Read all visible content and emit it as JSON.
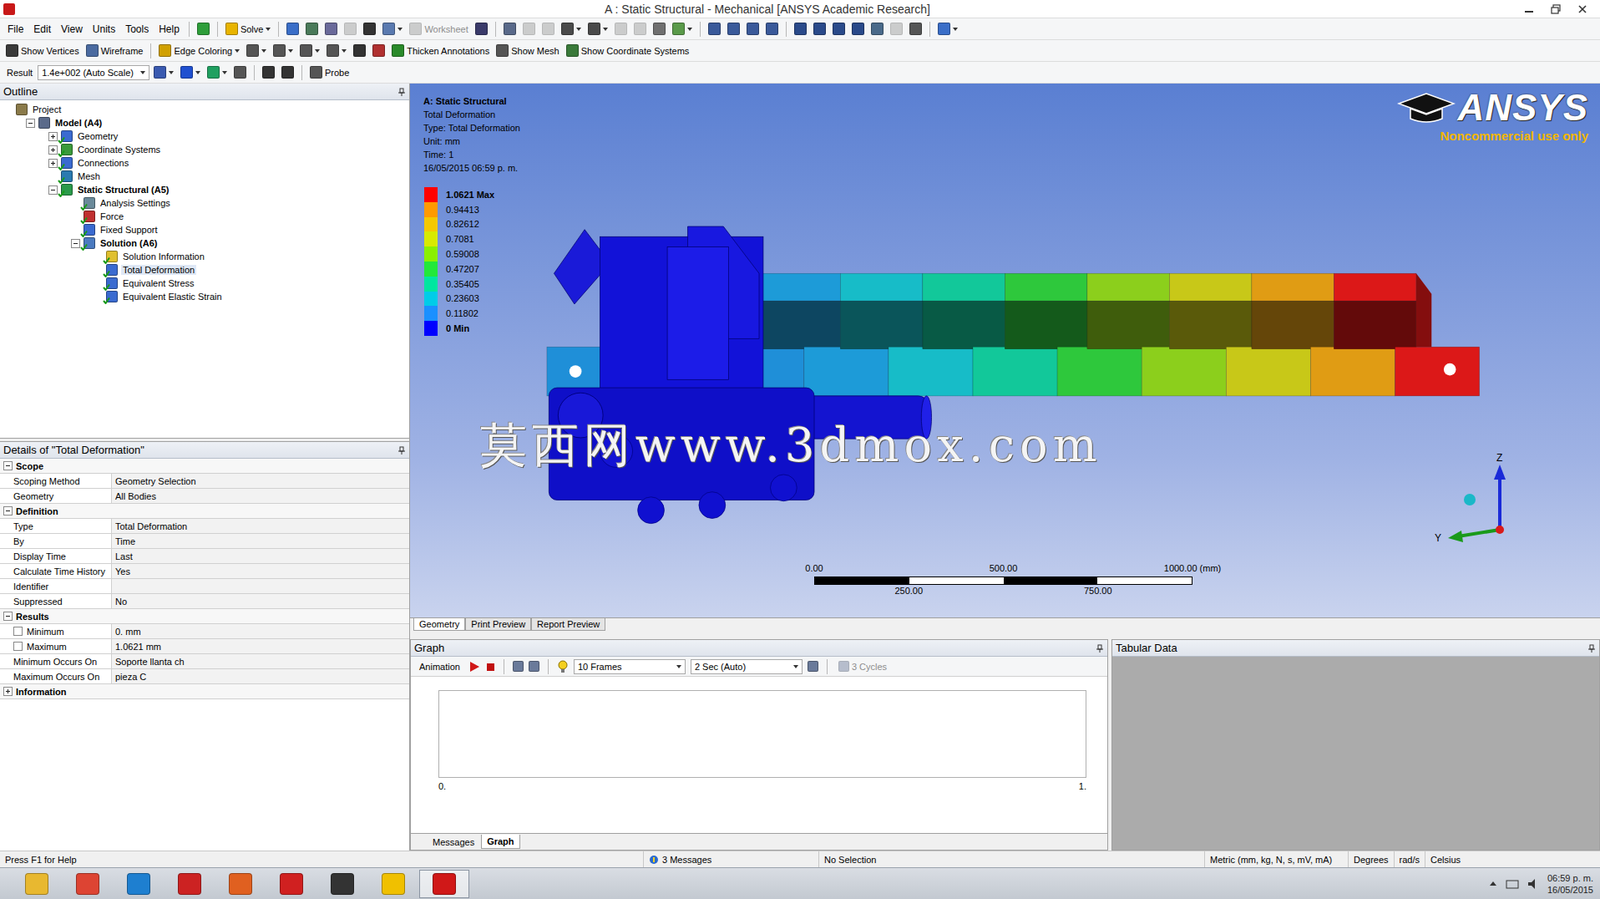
{
  "window": {
    "title": "A : Static Structural - Mechanical [ANSYS Academic Research]"
  },
  "menu": [
    "File",
    "Edit",
    "View",
    "Units",
    "Tools",
    "Help"
  ],
  "toolbars": [
    [
      {
        "kind": "sep"
      },
      {
        "kind": "icon",
        "color": "#2e9e3a",
        "dropdown": false,
        "disabled": false
      },
      {
        "kind": "sep"
      },
      {
        "kind": "button",
        "label": "Solve",
        "color": "#e8b400",
        "dropdown": true,
        "disabled": false
      },
      {
        "kind": "sep"
      },
      {
        "kind": "icon",
        "color": "#3a6ec8",
        "dropdown": false,
        "disabled": false
      },
      {
        "kind": "icon",
        "color": "#4a7a5a",
        "dropdown": false,
        "disabled": false
      },
      {
        "kind": "icon",
        "color": "#6a6a9a",
        "dropdown": false,
        "disabled": false
      },
      {
        "kind": "icon",
        "color": "#9a9a9a",
        "dropdown": false,
        "disabled": true
      },
      {
        "kind": "icon",
        "color": "#333333",
        "dropdown": false,
        "disabled": false
      },
      {
        "kind": "icon",
        "color": "#5a7ab0",
        "dropdown": true,
        "disabled": false
      },
      {
        "kind": "button",
        "label": "Worksheet",
        "color": "#9a9a9a",
        "dropdown": false,
        "disabled": true
      },
      {
        "kind": "icon",
        "color": "#3a3a6a",
        "dropdown": false,
        "disabled": false
      },
      {
        "kind": "sep"
      },
      {
        "kind": "icon",
        "color": "#5a6a8a",
        "dropdown": false,
        "disabled": false
      },
      {
        "kind": "icon",
        "color": "#9a9a9a",
        "dropdown": false,
        "disabled": true
      },
      {
        "kind": "icon",
        "color": "#9a9a9a",
        "dropdown": false,
        "disabled": true
      },
      {
        "kind": "icon",
        "color": "#4a4a4a",
        "dropdown": true,
        "disabled": false
      },
      {
        "kind": "icon",
        "color": "#4a4a4a",
        "dropdown": true,
        "disabled": false
      },
      {
        "kind": "icon",
        "color": "#9a9a9a",
        "dropdown": false,
        "disabled": true
      },
      {
        "kind": "icon",
        "color": "#9a9a9a",
        "dropdown": false,
        "disabled": true
      },
      {
        "kind": "icon",
        "color": "#707070",
        "dropdown": false,
        "disabled": false
      },
      {
        "kind": "icon",
        "color": "#5a9a4a",
        "dropdown": true,
        "disabled": false
      },
      {
        "kind": "sep"
      },
      {
        "kind": "icon",
        "color": "#3a5a9a",
        "dropdown": false,
        "disabled": false
      },
      {
        "kind": "icon",
        "color": "#3a5a9a",
        "dropdown": false,
        "disabled": false
      },
      {
        "kind": "icon",
        "color": "#3a5a9a",
        "dropdown": false,
        "disabled": false
      },
      {
        "kind": "icon",
        "color": "#3a5a9a",
        "dropdown": false,
        "disabled": false
      },
      {
        "kind": "sep"
      },
      {
        "kind": "icon",
        "color": "#2a4a8a",
        "dropdown": false,
        "disabled": false
      },
      {
        "kind": "icon",
        "color": "#2a4a8a",
        "dropdown": false,
        "disabled": false
      },
      {
        "kind": "icon",
        "color": "#2a4a8a",
        "dropdown": false,
        "disabled": false
      },
      {
        "kind": "icon",
        "color": "#2a4a8a",
        "dropdown": false,
        "disabled": false
      },
      {
        "kind": "icon",
        "color": "#4a6a8a",
        "dropdown": false,
        "disabled": false
      },
      {
        "kind": "icon",
        "color": "#9a9a9a",
        "dropdown": false,
        "disabled": true
      },
      {
        "kind": "icon",
        "color": "#555555",
        "dropdown": false,
        "disabled": false
      },
      {
        "kind": "sep"
      },
      {
        "kind": "icon",
        "color": "#3a6ec8",
        "dropdown": true,
        "disabled": false
      }
    ],
    [
      {
        "kind": "button",
        "label": "Show Vertices",
        "color": "#3a3a3a",
        "dropdown": false,
        "disabled": false
      },
      {
        "kind": "button",
        "label": "Wireframe",
        "color": "#4a6aa0",
        "dropdown": false,
        "disabled": false
      },
      {
        "kind": "sep"
      },
      {
        "kind": "button",
        "label": "Edge Coloring",
        "color": "#d0a000",
        "dropdown": true,
        "disabled": false
      },
      {
        "kind": "icon",
        "color": "#555555",
        "dropdown": true,
        "disabled": false
      },
      {
        "kind": "icon",
        "color": "#555555",
        "dropdown": true,
        "disabled": false
      },
      {
        "kind": "icon",
        "color": "#555555",
        "dropdown": true,
        "disabled": false
      },
      {
        "kind": "icon",
        "color": "#555555",
        "dropdown": true,
        "disabled": false
      },
      {
        "kind": "icon",
        "color": "#333333",
        "dropdown": false,
        "disabled": false
      },
      {
        "kind": "icon",
        "color": "#b03030",
        "dropdown": false,
        "disabled": false
      },
      {
        "kind": "button",
        "label": "Thicken Annotations",
        "color": "#2a8a2a",
        "dropdown": false,
        "disabled": false
      },
      {
        "kind": "button",
        "label": "Show Mesh",
        "color": "#555555",
        "dropdown": false,
        "disabled": false
      },
      {
        "kind": "button",
        "label": "Show Coordinate Systems",
        "color": "#3a7a3a",
        "dropdown": false,
        "disabled": false
      }
    ],
    [
      {
        "kind": "label",
        "label": "Result"
      },
      {
        "kind": "select",
        "label": "1.4e+002 (Auto Scale)"
      },
      {
        "kind": "icon",
        "color": "#3a5ab0",
        "dropdown": true,
        "disabled": false
      },
      {
        "kind": "icon",
        "color": "#2050d0",
        "dropdown": true,
        "disabled": false
      },
      {
        "kind": "icon",
        "color": "#20a060",
        "dropdown": true,
        "disabled": false
      },
      {
        "kind": "icon",
        "color": "#555555",
        "dropdown": false,
        "disabled": false
      },
      {
        "kind": "sep"
      },
      {
        "kind": "icon",
        "color": "#333333",
        "dropdown": false,
        "disabled": false
      },
      {
        "kind": "icon",
        "color": "#333333",
        "dropdown": false,
        "disabled": false
      },
      {
        "kind": "sep"
      },
      {
        "kind": "button",
        "label": "Probe",
        "color": "#555555",
        "dropdown": false,
        "disabled": false
      }
    ]
  ],
  "outline": {
    "title": "Outline",
    "items": [
      {
        "label": "Project",
        "depth": 0,
        "expandable": false,
        "expanded": true,
        "done": false,
        "selected": false,
        "icon_color": "#8a7a4a"
      },
      {
        "label": "Model (A4)",
        "depth": 1,
        "expandable": true,
        "expanded": true,
        "done": false,
        "selected": false,
        "icon_color": "#5a6a8a"
      },
      {
        "label": "Geometry",
        "depth": 2,
        "expandable": true,
        "expanded": false,
        "done": true,
        "selected": false,
        "icon_color": "#3a6ad0"
      },
      {
        "label": "Coordinate Systems",
        "depth": 2,
        "expandable": true,
        "expanded": false,
        "done": true,
        "selected": false,
        "icon_color": "#3a9a3a"
      },
      {
        "label": "Connections",
        "depth": 2,
        "expandable": true,
        "expanded": false,
        "done": true,
        "selected": false,
        "icon_color": "#3a6ad0"
      },
      {
        "label": "Mesh",
        "depth": 2,
        "expandable": false,
        "expanded": false,
        "done": true,
        "selected": false,
        "icon_color": "#2a7ab0"
      },
      {
        "label": "Static Structural (A5)",
        "depth": 2,
        "expandable": true,
        "expanded": true,
        "done": true,
        "selected": false,
        "icon_color": "#2a9a4a"
      },
      {
        "label": "Analysis Settings",
        "depth": 3,
        "expandable": false,
        "expanded": false,
        "done": true,
        "selected": false,
        "icon_color": "#6a8a9a"
      },
      {
        "label": "Force",
        "depth": 3,
        "expandable": false,
        "expanded": false,
        "done": true,
        "selected": false,
        "icon_color": "#c03030"
      },
      {
        "label": "Fixed Support",
        "depth": 3,
        "expandable": false,
        "expanded": false,
        "done": true,
        "selected": false,
        "icon_color": "#3a6ad0"
      },
      {
        "label": "Solution (A6)",
        "depth": 3,
        "expandable": true,
        "expanded": true,
        "done": true,
        "selected": false,
        "icon_color": "#4a7ac0"
      },
      {
        "label": "Solution Information",
        "depth": 4,
        "expandable": false,
        "expanded": false,
        "done": true,
        "selected": false,
        "icon_color": "#e0c030"
      },
      {
        "label": "Total Deformation",
        "depth": 4,
        "expandable": false,
        "expanded": false,
        "done": true,
        "selected": true,
        "icon_color": "#3a6ad0"
      },
      {
        "label": "Equivalent Stress",
        "depth": 4,
        "expandable": false,
        "expanded": false,
        "done": true,
        "selected": false,
        "icon_color": "#3a6ad0"
      },
      {
        "label": "Equivalent Elastic Strain",
        "depth": 4,
        "expandable": false,
        "expanded": false,
        "done": true,
        "selected": false,
        "icon_color": "#3a6ad0"
      }
    ]
  },
  "details": {
    "title": "Details of \"Total Deformation\"",
    "sections": [
      {
        "title": "Scope",
        "expanded": true,
        "rows": [
          {
            "label": "Scoping Method",
            "value": "Geometry Selection",
            "kind": "plain",
            "checked": false
          },
          {
            "label": "Geometry",
            "value": "All Bodies",
            "kind": "plain",
            "checked": false
          }
        ]
      },
      {
        "title": "Definition",
        "expanded": true,
        "rows": [
          {
            "label": "Type",
            "value": "Total Deformation",
            "kind": "plain",
            "checked": false
          },
          {
            "label": "By",
            "value": "Time",
            "kind": "plain",
            "checked": false
          },
          {
            "label": "Display Time",
            "value": "Last",
            "kind": "plain",
            "checked": false
          },
          {
            "label": "Calculate Time History",
            "value": "Yes",
            "kind": "plain",
            "checked": false
          },
          {
            "label": "Identifier",
            "value": "",
            "kind": "plain",
            "checked": false
          },
          {
            "label": "Suppressed",
            "value": "No",
            "kind": "plain",
            "checked": false
          }
        ]
      },
      {
        "title": "Results",
        "expanded": true,
        "rows": [
          {
            "label": "Minimum",
            "value": "0. mm",
            "kind": "check",
            "checked": false
          },
          {
            "label": "Maximum",
            "value": "1.0621 mm",
            "kind": "check",
            "checked": false
          },
          {
            "label": "Minimum Occurs On",
            "value": "Soporte llanta ch",
            "kind": "plain",
            "checked": false
          },
          {
            "label": "Maximum Occurs On",
            "value": "pieza C",
            "kind": "plain",
            "checked": false
          }
        ]
      },
      {
        "title": "Information",
        "expanded": false,
        "rows": []
      }
    ]
  },
  "viewport": {
    "info": [
      "A: Static Structural",
      "Total Deformation",
      "Type: Total Deformation",
      "Unit: mm",
      "Time: 1",
      "16/05/2015 06:59 p. m."
    ],
    "legend": [
      {
        "value": "1.0621 Max",
        "color": "#ff0000",
        "kind": "max"
      },
      {
        "value": "0.94413",
        "color": "#ff9a00",
        "kind": "level"
      },
      {
        "value": "0.82612",
        "color": "#f5c800",
        "kind": "level"
      },
      {
        "value": "0.7081",
        "color": "#d8ea00",
        "kind": "level"
      },
      {
        "value": "0.59008",
        "color": "#8af000",
        "kind": "level"
      },
      {
        "value": "0.47207",
        "color": "#22e83a",
        "kind": "level"
      },
      {
        "value": "0.35405",
        "color": "#00e6a0",
        "kind": "level"
      },
      {
        "value": "0.23603",
        "color": "#00cce8",
        "kind": "level"
      },
      {
        "value": "0.11802",
        "color": "#1a90ff",
        "kind": "level"
      },
      {
        "value": "0 Min",
        "color": "#0000ff",
        "kind": "min"
      }
    ],
    "logo": {
      "name": "ANSYS",
      "note": "Noncommercial use only"
    },
    "scale": {
      "top": [
        "0.00",
        "500.00",
        "1000.00 (mm)"
      ],
      "bottom": [
        "250.00",
        "750.00"
      ]
    },
    "axes": [
      "Z",
      "Y"
    ],
    "model": {
      "end_color": "#1f8fd8",
      "segments": [
        "#1d9bd8",
        "#17bcc8",
        "#12c89a",
        "#2ec83c",
        "#8ccf1c",
        "#c8c818",
        "#e09c14",
        "#dc1818"
      ]
    },
    "watermark": "莫西网www.3dmox.com",
    "tabs": [
      {
        "label": "Geometry",
        "selected": true
      },
      {
        "label": "Print Preview",
        "selected": false
      },
      {
        "label": "Report Preview",
        "selected": false
      }
    ]
  },
  "graph": {
    "title": "Graph",
    "animation_label": "Animation",
    "frames": "10 Frames",
    "duration": "2 Sec (Auto)",
    "cycles": "3 Cycles",
    "cycles_disabled": true,
    "x_ticks": [
      "0.",
      "1."
    ],
    "tabs": [
      {
        "label": "Messages",
        "selected": false
      },
      {
        "label": "Graph",
        "selected": true
      }
    ]
  },
  "tabular": {
    "title": "Tabular Data"
  },
  "status_bar": {
    "help": "Press F1 for Help",
    "messages": "3 Messages",
    "selection": "No Selection",
    "units": "Metric (mm, kg, N, s, mV, mA)",
    "angle": "Degrees",
    "rate": "rad/s",
    "temperature": "Celsius"
  },
  "taskbar": {
    "apps": [
      {
        "color": "#e8b830",
        "active": false
      },
      {
        "color": "#dd4433",
        "active": false
      },
      {
        "color": "#1e7fd0",
        "active": false
      },
      {
        "color": "#cc2222",
        "active": false
      },
      {
        "color": "#e06020",
        "active": false
      },
      {
        "color": "#d02020",
        "active": false
      },
      {
        "color": "#333333",
        "active": false
      },
      {
        "color": "#f0c000",
        "active": false
      },
      {
        "color": "#d01818",
        "active": true
      }
    ],
    "time": "06:59 p. m.",
    "date": "16/05/2015"
  }
}
